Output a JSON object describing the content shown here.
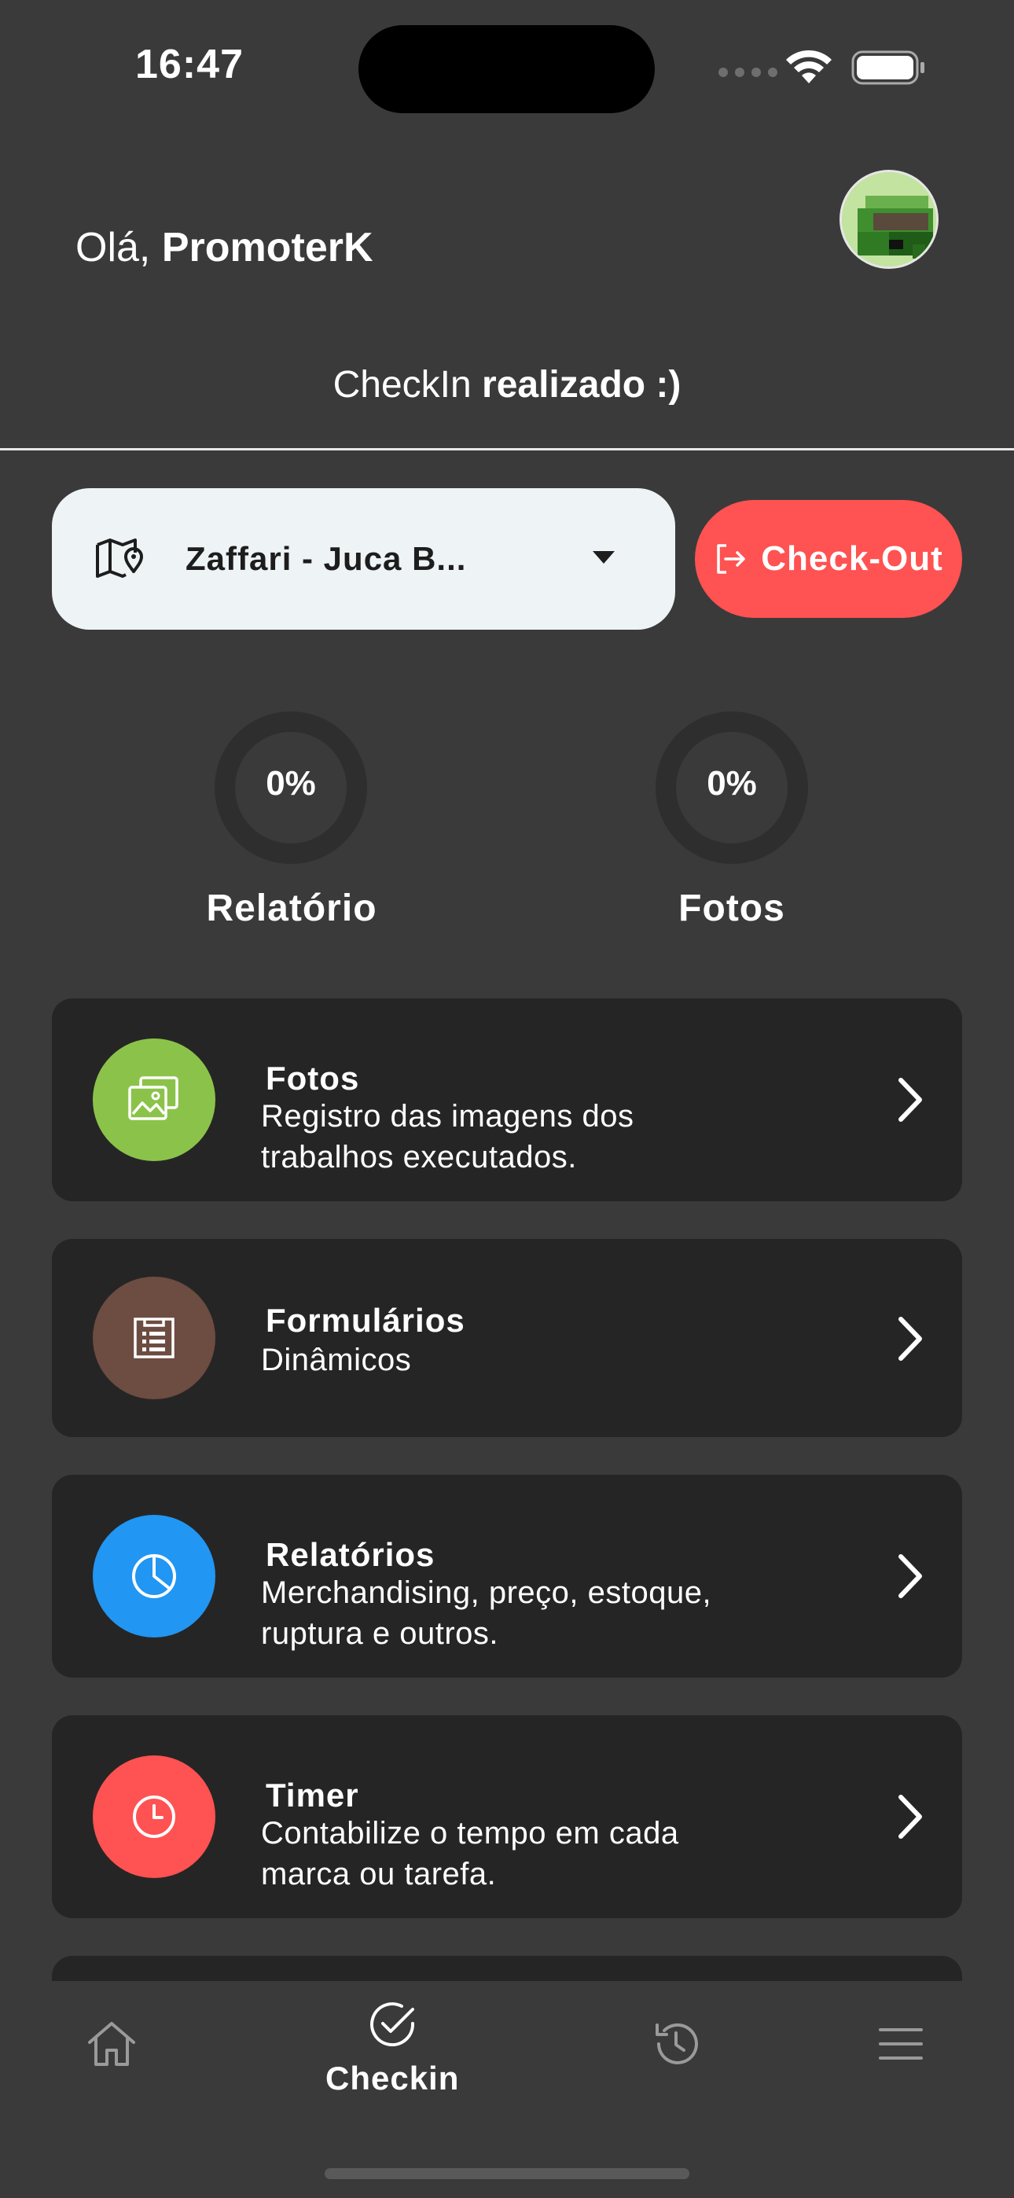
{
  "status_bar": {
    "time": "16:47"
  },
  "header": {
    "greeting_prefix": "Olá, ",
    "user_name": "PromoterK",
    "checkin_prefix": "CheckIn ",
    "checkin_status": "realizado :)"
  },
  "store": {
    "selected": "Zaffari - Juca B..."
  },
  "checkout": {
    "label": "Check-Out"
  },
  "progress": [
    {
      "value": "0%",
      "label": "Relatório"
    },
    {
      "value": "0%",
      "label": "Fotos"
    }
  ],
  "menu": [
    {
      "title": "Fotos",
      "desc_line1": "Registro das imagens dos",
      "desc_line2": "trabalhos executados.",
      "color": "#8bc34a",
      "icon": "photos-icon"
    },
    {
      "title": "Formulários",
      "desc_line1": "Dinâmicos",
      "desc_line2": "",
      "color": "#6d4c41",
      "icon": "form-icon"
    },
    {
      "title": "Relatórios",
      "desc_line1": "Merchandising, preço, estoque,",
      "desc_line2": "ruptura e outros.",
      "color": "#2196f3",
      "icon": "pie-chart-icon"
    },
    {
      "title": "Timer",
      "desc_line1": "Contabilize o tempo em cada",
      "desc_line2": "marca ou tarefa.",
      "color": "#ff5252",
      "icon": "clock-icon"
    }
  ],
  "bottom_nav": {
    "active_label": "Checkin"
  },
  "colors": {
    "background": "#3b3a3a",
    "card": "#262525",
    "accent_red": "#ff5252",
    "select_bg": "#eef3f6"
  }
}
